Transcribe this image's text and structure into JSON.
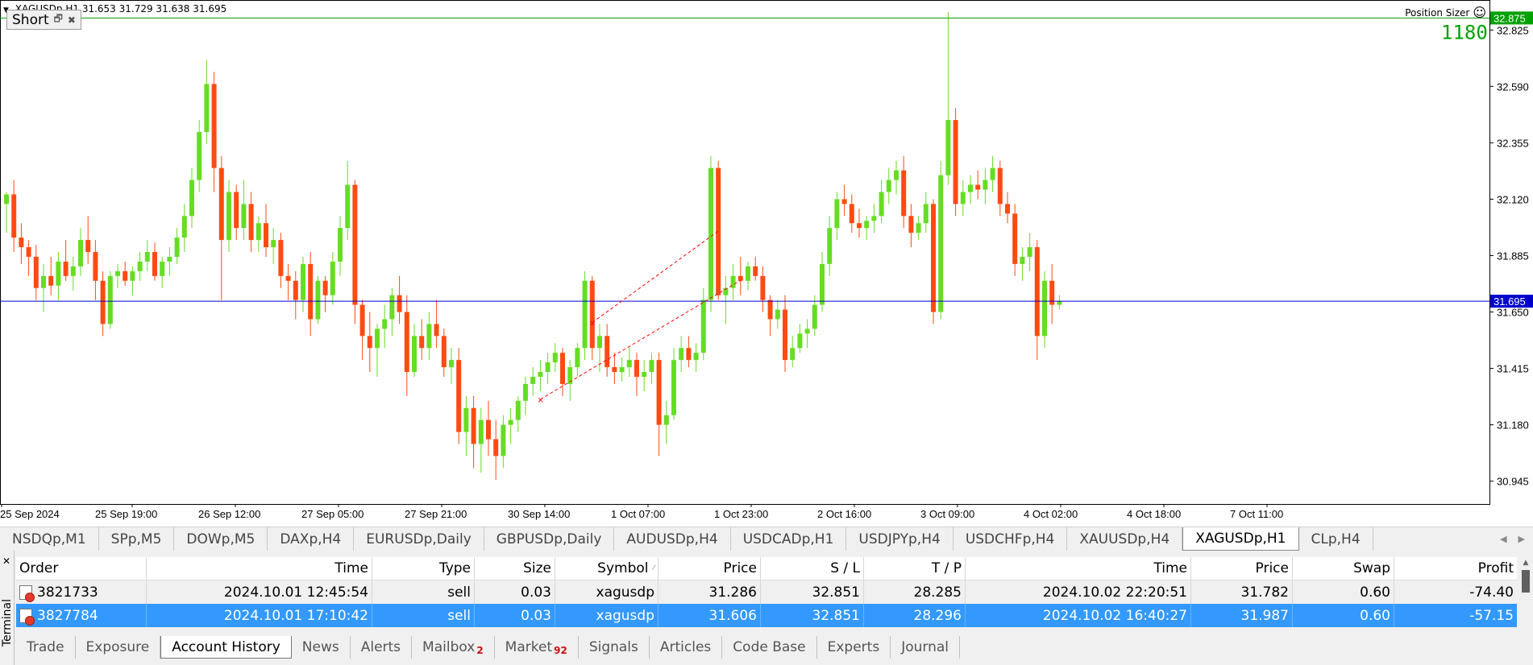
{
  "chart": {
    "symbol_timeframe": "XAGUSDp,H1",
    "ohlc_text": "31.653 31.729 31.638 31.695",
    "panel_title": "Short",
    "position_sizer_label": "Position Sizer",
    "sl_label_text": "1180",
    "price_ticks": [
      "32.825",
      "32.590",
      "32.355",
      "32.120",
      "31.885",
      "31.650",
      "31.415",
      "31.180",
      "30.945"
    ],
    "price_badge_green": "32.875",
    "price_badge_blue": "31.695",
    "time_labels": [
      "25 Sep 2024",
      "25 Sep 19:00",
      "26 Sep 12:00",
      "27 Sep 05:00",
      "27 Sep 21:00",
      "30 Sep 14:00",
      "1 Oct 07:00",
      "1 Oct 23:00",
      "2 Oct 16:00",
      "3 Oct 09:00",
      "4 Oct 02:00",
      "4 Oct 18:00",
      "7 Oct 11:00"
    ],
    "colors": {
      "bull": "#66dd22",
      "bear": "#ff4a12",
      "sl_line": "#00a000",
      "bid_line": "#0000cc",
      "trade_line": "#ff0000"
    }
  },
  "chart_data": {
    "type": "candlestick",
    "y_range": [
      30.85,
      32.95
    ],
    "candles": [
      [
        32.1,
        32.15,
        31.98,
        32.14
      ],
      [
        32.14,
        32.2,
        31.9,
        31.96
      ],
      [
        31.96,
        32.02,
        31.85,
        31.92
      ],
      [
        31.92,
        31.95,
        31.8,
        31.88
      ],
      [
        31.88,
        31.93,
        31.7,
        31.75
      ],
      [
        31.75,
        31.85,
        31.65,
        31.8
      ],
      [
        31.8,
        31.88,
        31.72,
        31.76
      ],
      [
        31.76,
        31.9,
        31.7,
        31.86
      ],
      [
        31.86,
        31.95,
        31.78,
        31.8
      ],
      [
        31.8,
        31.88,
        31.74,
        31.84
      ],
      [
        31.84,
        32.0,
        31.8,
        31.95
      ],
      [
        31.95,
        32.05,
        31.85,
        31.9
      ],
      [
        31.9,
        31.95,
        31.7,
        31.78
      ],
      [
        31.78,
        31.82,
        31.55,
        31.6
      ],
      [
        31.6,
        31.82,
        31.58,
        31.8
      ],
      [
        31.8,
        31.85,
        31.75,
        31.82
      ],
      [
        31.82,
        31.86,
        31.76,
        31.78
      ],
      [
        31.78,
        31.84,
        31.72,
        31.82
      ],
      [
        31.82,
        31.9,
        31.78,
        31.86
      ],
      [
        31.86,
        31.95,
        31.82,
        31.9
      ],
      [
        31.9,
        31.94,
        31.78,
        31.8
      ],
      [
        31.8,
        31.88,
        31.75,
        31.86
      ],
      [
        31.86,
        31.92,
        31.8,
        31.88
      ],
      [
        31.88,
        32.0,
        31.85,
        31.96
      ],
      [
        31.96,
        32.1,
        31.9,
        32.05
      ],
      [
        32.05,
        32.25,
        32.0,
        32.2
      ],
      [
        32.2,
        32.45,
        32.15,
        32.4
      ],
      [
        32.4,
        32.7,
        32.35,
        32.6
      ],
      [
        32.6,
        32.65,
        32.15,
        32.25
      ],
      [
        32.25,
        32.3,
        31.7,
        31.95
      ],
      [
        31.95,
        32.2,
        31.9,
        32.15
      ],
      [
        32.15,
        32.18,
        31.95,
        32.0
      ],
      [
        32.0,
        32.2,
        31.95,
        32.1
      ],
      [
        32.1,
        32.15,
        31.9,
        31.95
      ],
      [
        31.95,
        32.05,
        31.9,
        32.02
      ],
      [
        32.02,
        32.1,
        31.88,
        31.92
      ],
      [
        31.92,
        32.0,
        31.85,
        31.95
      ],
      [
        31.95,
        31.98,
        31.75,
        31.8
      ],
      [
        31.8,
        31.85,
        31.7,
        31.78
      ],
      [
        31.78,
        31.82,
        31.62,
        31.7
      ],
      [
        31.7,
        31.88,
        31.65,
        31.85
      ],
      [
        31.85,
        31.9,
        31.55,
        31.62
      ],
      [
        31.62,
        31.8,
        31.6,
        31.78
      ],
      [
        31.78,
        31.8,
        31.65,
        31.72
      ],
      [
        31.72,
        31.9,
        31.68,
        31.86
      ],
      [
        31.86,
        32.05,
        31.8,
        32.0
      ],
      [
        32.0,
        32.28,
        31.95,
        32.18
      ],
      [
        32.18,
        32.2,
        31.6,
        31.68
      ],
      [
        31.68,
        31.7,
        31.45,
        31.55
      ],
      [
        31.55,
        31.65,
        31.4,
        31.5
      ],
      [
        31.5,
        31.6,
        31.38,
        31.58
      ],
      [
        31.58,
        31.68,
        31.5,
        31.62
      ],
      [
        31.62,
        31.75,
        31.55,
        31.72
      ],
      [
        31.72,
        31.8,
        31.6,
        31.65
      ],
      [
        31.65,
        31.72,
        31.3,
        31.4
      ],
      [
        31.4,
        31.6,
        31.38,
        31.55
      ],
      [
        31.55,
        31.62,
        31.45,
        31.5
      ],
      [
        31.5,
        31.65,
        31.45,
        31.6
      ],
      [
        31.6,
        31.7,
        31.5,
        31.55
      ],
      [
        31.55,
        31.58,
        31.38,
        31.42
      ],
      [
        31.42,
        31.5,
        31.35,
        31.45
      ],
      [
        31.45,
        31.5,
        31.1,
        31.15
      ],
      [
        31.15,
        31.3,
        31.05,
        31.25
      ],
      [
        31.25,
        31.3,
        31.0,
        31.1
      ],
      [
        31.1,
        31.25,
        30.98,
        31.2
      ],
      [
        31.2,
        31.28,
        31.05,
        31.12
      ],
      [
        31.12,
        31.2,
        30.95,
        31.05
      ],
      [
        31.05,
        31.22,
        31.0,
        31.18
      ],
      [
        31.18,
        31.25,
        31.1,
        31.2
      ],
      [
        31.2,
        31.3,
        31.15,
        31.28
      ],
      [
        31.28,
        31.38,
        31.22,
        31.35
      ],
      [
        31.35,
        31.42,
        31.3,
        31.38
      ],
      [
        31.38,
        31.45,
        31.32,
        31.4
      ],
      [
        31.4,
        31.48,
        31.35,
        31.44
      ],
      [
        31.44,
        31.52,
        31.4,
        31.48
      ],
      [
        31.48,
        31.5,
        31.3,
        31.35
      ],
      [
        31.35,
        31.45,
        31.28,
        31.42
      ],
      [
        31.42,
        31.52,
        31.38,
        31.5
      ],
      [
        31.5,
        31.82,
        31.45,
        31.78
      ],
      [
        31.78,
        31.8,
        31.45,
        31.5
      ],
      [
        31.5,
        31.6,
        31.4,
        31.55
      ],
      [
        31.55,
        31.6,
        31.38,
        31.42
      ],
      [
        31.42,
        31.48,
        31.35,
        31.4
      ],
      [
        31.4,
        31.46,
        31.36,
        31.42
      ],
      [
        31.42,
        31.5,
        31.38,
        31.45
      ],
      [
        31.45,
        31.48,
        31.3,
        31.38
      ],
      [
        31.38,
        31.45,
        31.32,
        31.4
      ],
      [
        31.4,
        31.48,
        31.35,
        31.45
      ],
      [
        31.45,
        31.48,
        31.05,
        31.18
      ],
      [
        31.18,
        31.28,
        31.1,
        31.22
      ],
      [
        31.22,
        31.5,
        31.2,
        31.45
      ],
      [
        31.45,
        31.55,
        31.4,
        31.5
      ],
      [
        31.5,
        31.55,
        31.42,
        31.45
      ],
      [
        31.45,
        31.52,
        31.4,
        31.48
      ],
      [
        31.48,
        31.75,
        31.45,
        31.7
      ],
      [
        31.7,
        32.3,
        31.65,
        32.25
      ],
      [
        32.25,
        32.28,
        31.7,
        31.72
      ],
      [
        31.72,
        31.8,
        31.6,
        31.75
      ],
      [
        31.75,
        31.85,
        31.7,
        31.8
      ],
      [
        31.8,
        31.88,
        31.72,
        31.78
      ],
      [
        31.78,
        31.86,
        31.74,
        31.84
      ],
      [
        31.84,
        31.88,
        31.78,
        31.8
      ],
      [
        31.8,
        31.84,
        31.65,
        31.7
      ],
      [
        31.7,
        31.72,
        31.55,
        31.62
      ],
      [
        31.62,
        31.7,
        31.58,
        31.66
      ],
      [
        31.66,
        31.72,
        31.4,
        31.45
      ],
      [
        31.45,
        31.55,
        31.42,
        31.5
      ],
      [
        31.5,
        31.6,
        31.48,
        31.56
      ],
      [
        31.56,
        31.62,
        31.5,
        31.58
      ],
      [
        31.58,
        31.72,
        31.55,
        31.68
      ],
      [
        31.68,
        31.9,
        31.65,
        31.85
      ],
      [
        31.85,
        32.05,
        31.8,
        32.0
      ],
      [
        32.0,
        32.15,
        31.95,
        32.12
      ],
      [
        32.12,
        32.18,
        32.05,
        32.1
      ],
      [
        32.1,
        32.14,
        31.98,
        32.02
      ],
      [
        32.02,
        32.08,
        31.96,
        32.0
      ],
      [
        32.0,
        32.05,
        31.95,
        32.03
      ],
      [
        32.03,
        32.1,
        31.98,
        32.05
      ],
      [
        32.05,
        32.2,
        32.02,
        32.15
      ],
      [
        32.15,
        32.25,
        32.1,
        32.2
      ],
      [
        32.2,
        32.28,
        32.14,
        32.24
      ],
      [
        32.24,
        32.3,
        32.0,
        32.05
      ],
      [
        32.05,
        32.1,
        31.92,
        31.98
      ],
      [
        31.98,
        32.05,
        31.95,
        32.02
      ],
      [
        32.02,
        32.15,
        31.98,
        32.1
      ],
      [
        32.1,
        32.12,
        31.6,
        31.65
      ],
      [
        31.65,
        32.28,
        31.62,
        32.22
      ],
      [
        32.22,
        32.9,
        32.18,
        32.45
      ],
      [
        32.45,
        32.5,
        32.05,
        32.1
      ],
      [
        32.1,
        32.2,
        32.05,
        32.15
      ],
      [
        32.15,
        32.22,
        32.1,
        32.18
      ],
      [
        32.18,
        32.24,
        32.12,
        32.16
      ],
      [
        32.16,
        32.25,
        32.1,
        32.2
      ],
      [
        32.2,
        32.3,
        32.15,
        32.25
      ],
      [
        32.25,
        32.28,
        32.05,
        32.1
      ],
      [
        32.1,
        32.15,
        32.02,
        32.06
      ],
      [
        32.06,
        32.1,
        31.8,
        31.85
      ],
      [
        31.85,
        31.92,
        31.78,
        31.88
      ],
      [
        31.88,
        31.98,
        31.82,
        31.92
      ],
      [
        31.92,
        31.95,
        31.45,
        31.55
      ],
      [
        31.55,
        31.82,
        31.5,
        31.78
      ],
      [
        31.78,
        31.85,
        31.6,
        31.68
      ],
      [
        31.68,
        31.72,
        31.66,
        31.695
      ]
    ],
    "lines": {
      "sl": 32.875,
      "bid": 31.695
    },
    "trades": [
      {
        "entry_price": 31.286,
        "exit_price": 31.782
      },
      {
        "entry_price": 31.606,
        "exit_price": 31.987
      }
    ]
  },
  "symbol_tabs": [
    "NSDQp,M1",
    "SPp,M5",
    "DOWp,M5",
    "DAXp,H4",
    "EURUSDp,Daily",
    "GBPUSDp,Daily",
    "AUDUSDp,H4",
    "USDCADp,H1",
    "USDJPYp,H4",
    "USDCHFp,H4",
    "XAUUSDp,H4",
    "XAGUSDp,H1",
    "CLp,H4"
  ],
  "active_symbol_tab": "XAGUSDp,H1",
  "terminal": {
    "side_label": "Terminal",
    "columns": [
      "Order",
      "Time",
      "Type",
      "Size",
      "Symbol",
      "Price",
      "S / L",
      "T / P",
      "Time",
      "Price",
      "Swap",
      "Profit"
    ],
    "rows": [
      [
        "3821733",
        "2024.10.01 12:45:54",
        "sell",
        "0.03",
        "xagusdp",
        "31.286",
        "32.851",
        "28.285",
        "2024.10.02 22:20:51",
        "31.782",
        "0.60",
        "-74.40"
      ],
      [
        "3827784",
        "2024.10.01 17:10:42",
        "sell",
        "0.03",
        "xagusdp",
        "31.606",
        "32.851",
        "28.296",
        "2024.10.02 16:40:27",
        "31.987",
        "0.60",
        "-57.15"
      ]
    ],
    "tabs": [
      {
        "label": "Trade",
        "badge": ""
      },
      {
        "label": "Exposure",
        "badge": ""
      },
      {
        "label": "Account History",
        "badge": "",
        "active": true
      },
      {
        "label": "News",
        "badge": ""
      },
      {
        "label": "Alerts",
        "badge": ""
      },
      {
        "label": "Mailbox",
        "badge": "2"
      },
      {
        "label": "Market",
        "badge": "92"
      },
      {
        "label": "Signals",
        "badge": ""
      },
      {
        "label": "Articles",
        "badge": ""
      },
      {
        "label": "Code Base",
        "badge": ""
      },
      {
        "label": "Experts",
        "badge": ""
      },
      {
        "label": "Journal",
        "badge": ""
      }
    ]
  }
}
